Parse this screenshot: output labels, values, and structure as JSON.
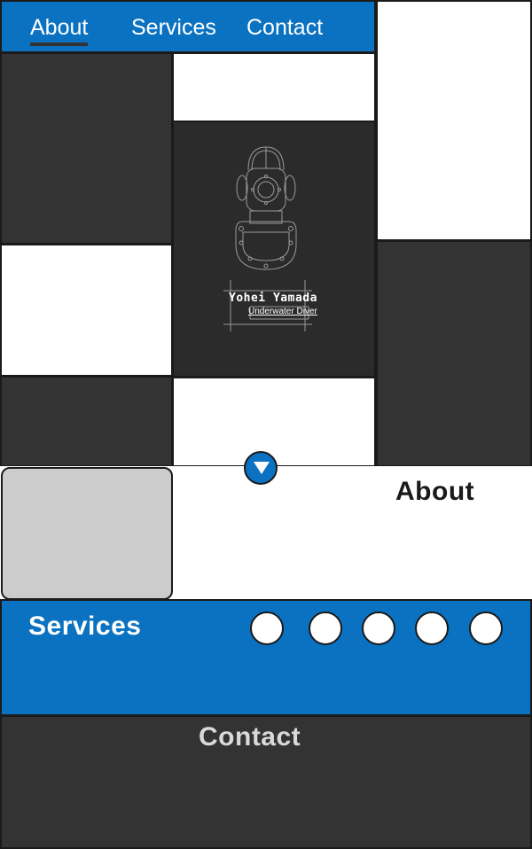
{
  "nav": {
    "links": [
      {
        "label": "About",
        "active": true
      },
      {
        "label": "Services",
        "active": false
      },
      {
        "label": "Contact",
        "active": false
      }
    ],
    "icon_buttons": [
      "circle-icon",
      "circle-icon",
      "circle-icon"
    ]
  },
  "hero": {
    "logo_icon": "diving-helmet-icon",
    "name": "Yohei Yamada",
    "tagline": "Underwater Diver",
    "scroll_icon": "down-triangle-icon"
  },
  "about": {
    "title": "About",
    "image": "placeholder-image"
  },
  "services": {
    "title": "Services",
    "circle_count": 5
  },
  "contact": {
    "title": "Contact"
  },
  "colors": {
    "brand_blue": "#0b72c1",
    "dark_tile": "#333333",
    "light_tile": "#ffffff",
    "placeholder_gray": "#cccccc"
  }
}
